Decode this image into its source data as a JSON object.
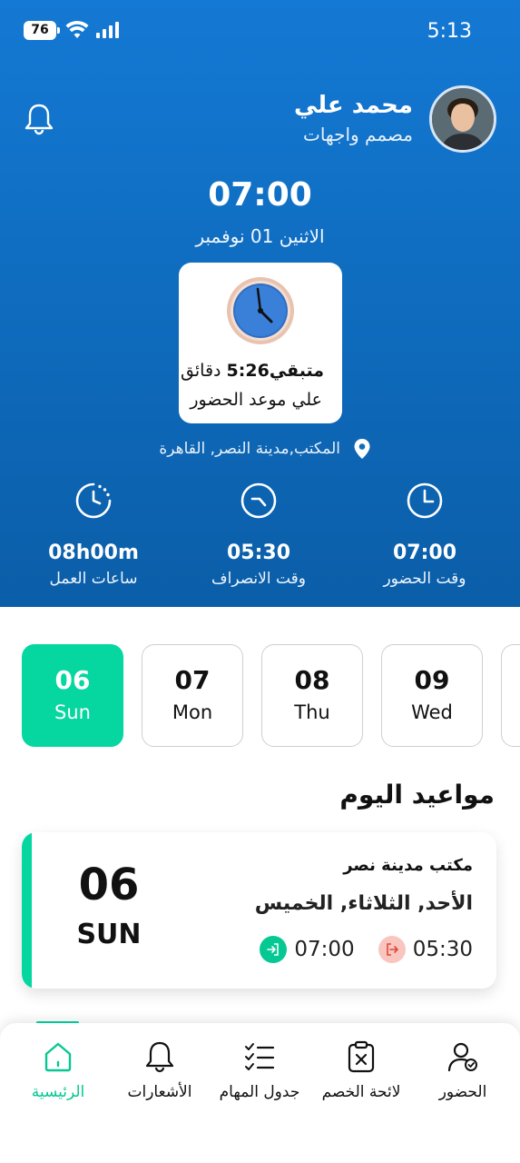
{
  "status_bar": {
    "battery": "76",
    "time": "5:13"
  },
  "profile": {
    "name": "محمد علي",
    "role": "مصمم واجهات"
  },
  "clock": {
    "time": "07:00",
    "date": "الاثنين 01 نوفمبر"
  },
  "remaining": {
    "prefix": "متبقي",
    "value": "5:26",
    "unit": "دقائق",
    "subtitle": "علي موعد الحضور"
  },
  "location": "المكتب,مدينة النصر, القاهرة",
  "stats": [
    {
      "value": "08h00m",
      "label": "ساعات العمل",
      "icon": "timer-icon"
    },
    {
      "value": "05:30",
      "label": "وقت الانصراف",
      "icon": "clock-out-icon"
    },
    {
      "value": "07:00",
      "label": "وقت الحضور",
      "icon": "clock-in-icon"
    }
  ],
  "days": [
    {
      "num": "06",
      "name": "Sun",
      "active": true
    },
    {
      "num": "07",
      "name": "Mon",
      "active": false
    },
    {
      "num": "08",
      "name": "Thu",
      "active": false
    },
    {
      "num": "09",
      "name": "Wed",
      "active": false
    }
  ],
  "section_title": "مواعيد اليوم",
  "appointment": {
    "day_num": "06",
    "day_name": "SUN",
    "office": "مكتب مدينة نصر",
    "days": "الأحد, الثلاثاء, الخميس",
    "check_in": "07:00",
    "check_out": "05:30"
  },
  "nav": [
    {
      "label": "الرئيسية",
      "icon": "home-icon",
      "active": true
    },
    {
      "label": "الأشعارات",
      "icon": "bell-icon",
      "active": false
    },
    {
      "label": "جدول المهام",
      "icon": "task-list-icon",
      "active": false
    },
    {
      "label": "لائحة الخصم",
      "icon": "deduction-clipboard-icon",
      "active": false
    },
    {
      "label": "الحضور",
      "icon": "attendance-user-icon",
      "active": false
    }
  ],
  "colors": {
    "primary": "#0f6dc0",
    "accent": "#06d6a0",
    "checkout": "#f9c6bf"
  }
}
